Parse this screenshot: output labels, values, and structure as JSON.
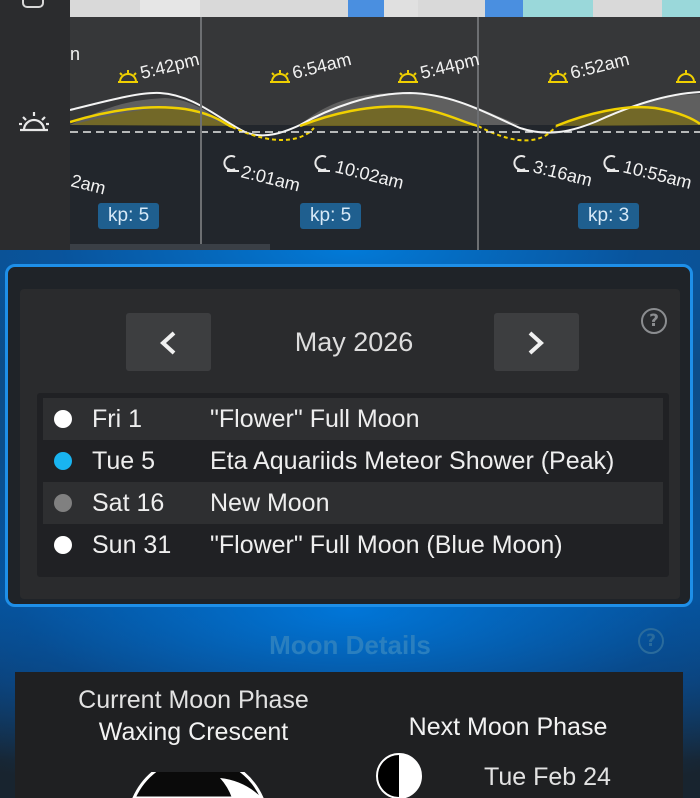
{
  "timeline": {
    "events": [
      {
        "label": "5:42pm",
        "kind": "sunset"
      },
      {
        "label": "6:54am",
        "kind": "sunrise"
      },
      {
        "label": "5:44pm",
        "kind": "sunset"
      },
      {
        "label": "6:52am",
        "kind": "sunrise"
      },
      {
        "label": "2:01am",
        "kind": "moonrise"
      },
      {
        "label": "10:02am",
        "kind": "moonset"
      },
      {
        "label": "3:16am",
        "kind": "moonrise"
      },
      {
        "label": "10:55am",
        "kind": "moonset"
      }
    ],
    "partial_labels": {
      "left_top": "n",
      "left_bottom": "2am"
    },
    "kp": [
      "kp: 5",
      "kp: 5",
      "kp: 3"
    ]
  },
  "calendar": {
    "month": "May 2026",
    "help": "?",
    "events": [
      {
        "date": "Fri 1",
        "name": "\"Flower\" Full Moon",
        "dot_color": "#ffffff"
      },
      {
        "date": "Tue 5",
        "name": "Eta Aquariids Meteor Shower (Peak)",
        "dot_color": "#19b4f0"
      },
      {
        "date": "Sat 16",
        "name": "New Moon",
        "dot_color": "#808080"
      },
      {
        "date": "Sun 31",
        "name": "\"Flower\" Full Moon (Blue Moon)",
        "dot_color": "#ffffff"
      }
    ]
  },
  "moon": {
    "title": "Moon Details",
    "help": "?",
    "current_label": "Current Moon Phase",
    "current_phase": "Waxing Crescent",
    "next_label": "Next Moon Phase",
    "next_date": "Tue Feb 24"
  },
  "colors": {
    "accent": "#1e8fe8",
    "sun": "#f0d000",
    "kp_badge": "#1f5f8f"
  },
  "icons": {
    "rail": "sun-icon",
    "prev": "chevron-left-icon",
    "next": "chevron-right-icon"
  }
}
